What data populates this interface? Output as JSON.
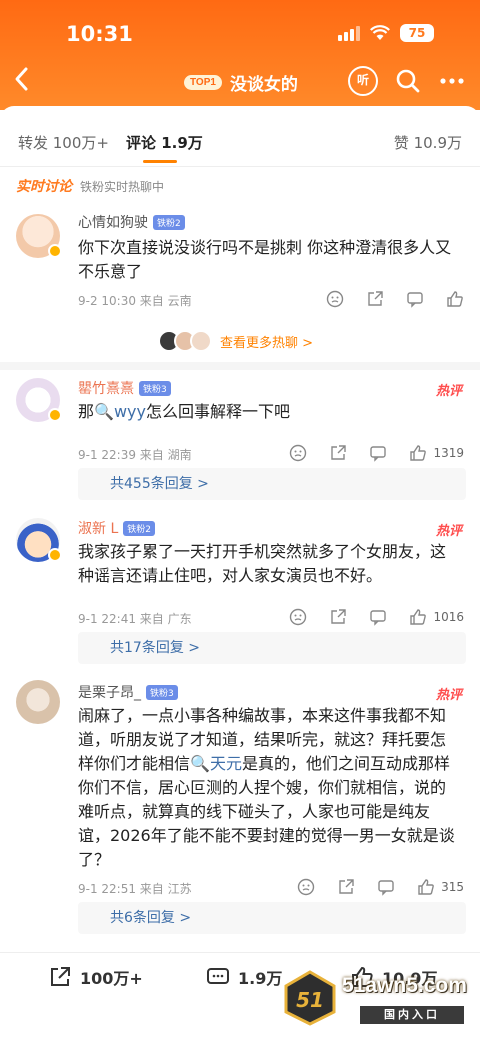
{
  "status_bar": {
    "time": "10:31",
    "battery": "75"
  },
  "nav": {
    "topic_badge": "TOP1",
    "topic_title": "没谈女的",
    "listen_label": "听"
  },
  "tabs": {
    "repost": "转发 100万+",
    "comments": "评论 1.9万",
    "likes": "赞 10.9万"
  },
  "live": {
    "tag": "实时讨论",
    "sub": "铁粉实时热聊中"
  },
  "comments": [
    {
      "name": "心情如狗驶",
      "fan": "铁粉2",
      "text": "你下次直接说没谈行吗不是挑刺 你这种澄清很多人又不乐意了",
      "meta": "9-2 10:30 来自 云南",
      "likes": ""
    },
    {
      "name": "罌竹熹熹",
      "fan": "铁粉3",
      "hot": "热评",
      "text_pre": "那",
      "link": "wyy",
      "text_post": "怎么回事解释一下吧",
      "meta": "9-1 22:39 来自 湖南",
      "likes": "1319",
      "replies": "共455条回复 >"
    },
    {
      "name": "淑新 L",
      "fan": "铁粉2",
      "hot": "热评",
      "text": "我家孩子累了一天打开手机突然就多了个女朋友，这种谣言还请止住吧，对人家女演员也不好。",
      "meta": "9-1 22:41 来自 广东",
      "likes": "1016",
      "replies": "共17条回复 >"
    },
    {
      "name": "是栗子昂_",
      "fan": "铁粉3",
      "hot": "热评",
      "text_pre": "闹麻了，一点小事各种编故事，本来这件事我都不知道，听朋友说了才知道，结果听完，就这？拜托要怎样你们才能相信",
      "link": "天元",
      "text_post": "是真的，他们之间互动成那样你们不信，居心叵测的人捏个嫂，你们就相信，说的难听点，就算真的线下碰头了，人家也可能是纯友谊，2026年了能不能不要封建的觉得一男一女就是谈了？",
      "meta": "9-1 22:51 来自 江苏",
      "likes": "315",
      "replies": "共6条回复 >"
    }
  ],
  "more_hot": "查看更多热聊 >",
  "bottom_bar": {
    "repost": "100万+",
    "comment": "1.9万",
    "like": "10.9万"
  },
  "watermark": {
    "domain": "51awn5.com",
    "sub": "国内入口",
    "logo_text": "51"
  },
  "colors": {
    "brand_orange": "#ff7a1f",
    "link_blue": "#3e6ea8",
    "hot_red": "#ff4e4e"
  }
}
